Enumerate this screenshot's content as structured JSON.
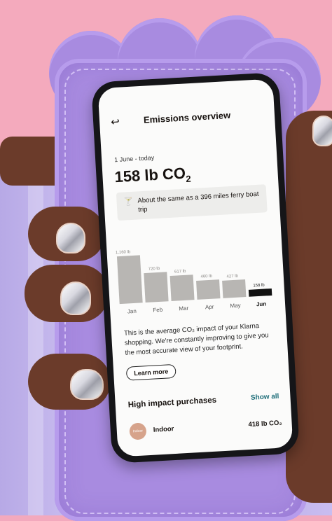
{
  "header": {
    "back_icon": "arrow-left-icon",
    "title": "Emissions overview"
  },
  "summary": {
    "period": "1 June - today",
    "total_value": "158 lb CO",
    "total_subscript": "2"
  },
  "fact_card": {
    "icon": "cocktail-icon",
    "text": "About the same as a 396 miles ferry boat trip"
  },
  "chart_data": {
    "type": "bar",
    "categories": [
      "Jan",
      "Feb",
      "Mar",
      "Apr",
      "May",
      "Jun"
    ],
    "values": [
      1160,
      720,
      617,
      460,
      427,
      158
    ],
    "value_labels": [
      "1,160 lb",
      "720 lb",
      "617 lb",
      "460 lb",
      "427 lb",
      "158 lb"
    ],
    "ylim": [
      0,
      1160
    ],
    "colors": {
      "past": "#b8b6b3",
      "current": "#111111"
    }
  },
  "description": "This is the average CO₂ impact of your Klarna shopping. We're constantly improving to give you the most accurate view of your footprint.",
  "learn_more_label": "Learn more",
  "purchases": {
    "title": "High impact purchases",
    "show_all_label": "Show all",
    "items": [
      {
        "avatar_text": "Indoor",
        "name": "Indoor",
        "value": "418 lb CO₂"
      }
    ]
  },
  "colors": {
    "accent": "#1f6f7a",
    "case": "#a88be0",
    "background": "#f4aabd"
  }
}
